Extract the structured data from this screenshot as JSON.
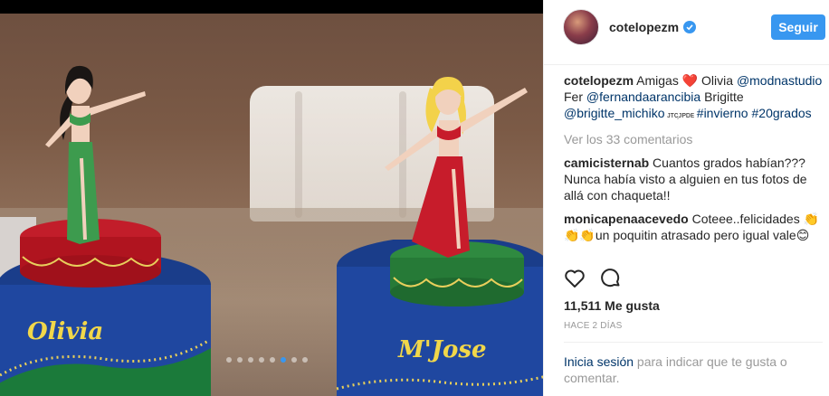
{
  "post": {
    "image": {
      "alt": "",
      "cake_left_name": "Olivia",
      "cake_right_name": "M'Jose",
      "carousel_dots": 8,
      "active_dot_index": 5
    }
  },
  "header": {
    "username": "cotelopezm",
    "verified": true,
    "follow_label": "Seguir"
  },
  "caption": {
    "username": "cotelopezm",
    "segments": [
      {
        "text": " Amigas ❤️ Olivia ",
        "type": "text"
      },
      {
        "text": "@modnastudio",
        "type": "link"
      },
      {
        "text": " Fer ",
        "type": "text"
      },
      {
        "text": "@fernandaarancibia",
        "type": "link"
      },
      {
        "text": " Brigitte ",
        "type": "text"
      },
      {
        "text": "@brigitte_michiko",
        "type": "link"
      },
      {
        "text": " ᴊᴛᴄ᷊ᴊᴘᴅᴇ ",
        "type": "text"
      },
      {
        "text": "#invierno",
        "type": "link"
      },
      {
        "text": " ",
        "type": "text"
      },
      {
        "text": "#20grados",
        "type": "link"
      }
    ]
  },
  "view_comments": "Ver los 33 comentarios",
  "comments": [
    {
      "username": "camicisternab",
      "text": " Cuantos grados habían??? Nunca había visto a alguien en tus fotos de allá con chaqueta!!"
    },
    {
      "username": "monicapenaacevedo",
      "text": " Coteee..felicidades 👏👏👏un poquitin atrasado pero igual vale😊"
    }
  ],
  "likes": "11,511 Me gusta",
  "timestamp": "HACE 2 DÍAS",
  "login_prompt": {
    "link": "Inicia sesión",
    "rest": " para indicar que te gusta o comentar."
  },
  "colors": {
    "accent": "#3897f0",
    "link": "#003569",
    "muted": "#999999",
    "text": "#262626"
  },
  "icons": [
    "verified-badge-icon",
    "heart-icon",
    "comment-icon"
  ]
}
